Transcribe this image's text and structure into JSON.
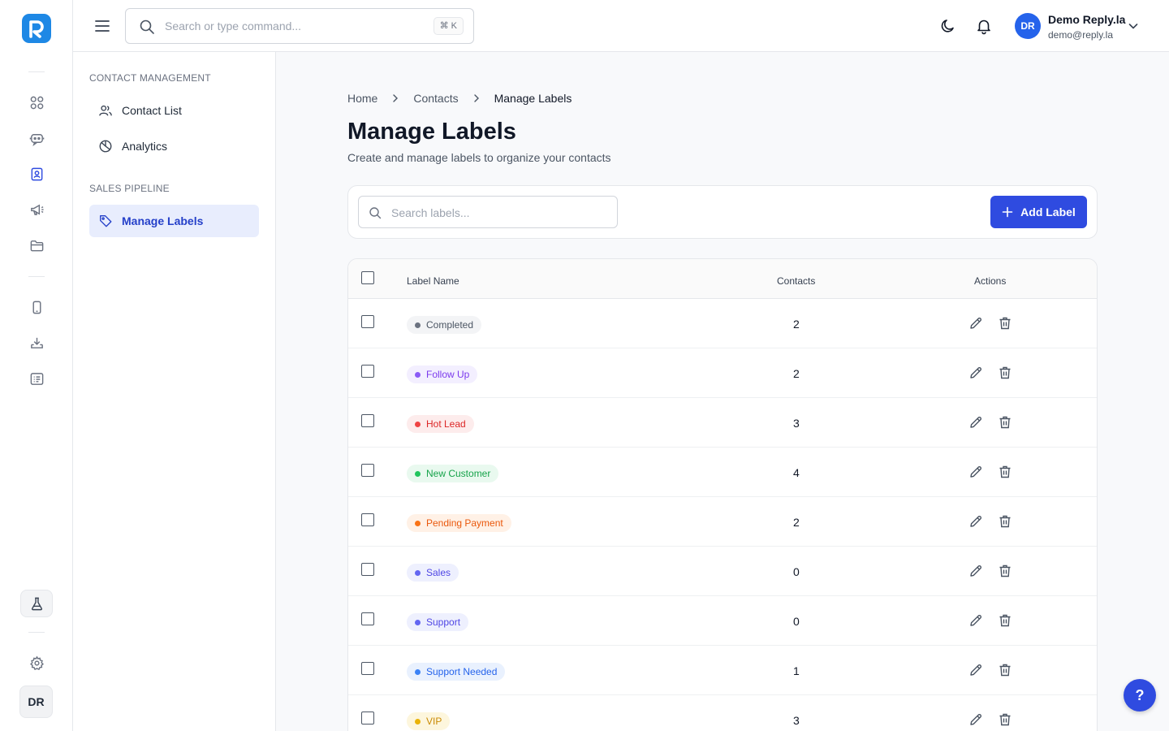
{
  "app": {
    "logo_letter": "R",
    "brand_color": "#1e88e5",
    "accent": "#2f4be0"
  },
  "rail": {
    "icons": [
      "dashboard-icon",
      "chat-bot-icon",
      "contacts-icon",
      "megaphone-icon",
      "folder-icon",
      "phone-icon",
      "download-icon",
      "list-icon",
      "flask-icon",
      "settings-icon"
    ],
    "avatar": "DR"
  },
  "header": {
    "search_placeholder": "Search or type command...",
    "shortcut": "⌘ K",
    "user": {
      "initials": "DR",
      "name": "Demo Reply.la",
      "email": "demo@reply.la"
    }
  },
  "sidebar": {
    "sections": [
      {
        "label": "CONTACT MANAGEMENT",
        "items": [
          {
            "label": "Contact List",
            "icon": "users-icon",
            "active": false
          },
          {
            "label": "Analytics",
            "icon": "pie-chart-icon",
            "active": false
          }
        ]
      },
      {
        "label": "SALES PIPELINE",
        "items": [
          {
            "label": "Manage Labels",
            "icon": "tag-icon",
            "active": true
          }
        ]
      }
    ]
  },
  "breadcrumb": [
    "Home",
    "Contacts",
    "Manage Labels"
  ],
  "page": {
    "title": "Manage Labels",
    "subtitle": "Create and manage labels to organize your contacts"
  },
  "toolbar": {
    "search_placeholder": "Search labels...",
    "add_label": "Add Label"
  },
  "table": {
    "columns": [
      "Label Name",
      "Contacts",
      "Actions"
    ],
    "rows": [
      {
        "label": "Completed",
        "contacts": "2",
        "color": "#6b7280",
        "bg": "#f3f4f6",
        "text": "#4b5563"
      },
      {
        "label": "Follow Up",
        "contacts": "2",
        "color": "#8b5cf6",
        "bg": "#f3efff",
        "text": "#7c3aed"
      },
      {
        "label": "Hot Lead",
        "contacts": "3",
        "color": "#ef4444",
        "bg": "#fdecec",
        "text": "#dc2626"
      },
      {
        "label": "New Customer",
        "contacts": "4",
        "color": "#22c55e",
        "bg": "#e9f9ef",
        "text": "#16a34a"
      },
      {
        "label": "Pending Payment",
        "contacts": "2",
        "color": "#f97316",
        "bg": "#fff1e6",
        "text": "#ea580c"
      },
      {
        "label": "Sales",
        "contacts": "0",
        "color": "#6366f1",
        "bg": "#eef0fe",
        "text": "#4f46e5"
      },
      {
        "label": "Support",
        "contacts": "0",
        "color": "#6366f1",
        "bg": "#eef0fe",
        "text": "#4f46e5"
      },
      {
        "label": "Support Needed",
        "contacts": "1",
        "color": "#3b82f6",
        "bg": "#e9f1fe",
        "text": "#2563eb"
      },
      {
        "label": "VIP",
        "contacts": "3",
        "color": "#eab308",
        "bg": "#fdf6dd",
        "text": "#ca8a04"
      }
    ]
  },
  "help": {
    "label": "?"
  }
}
